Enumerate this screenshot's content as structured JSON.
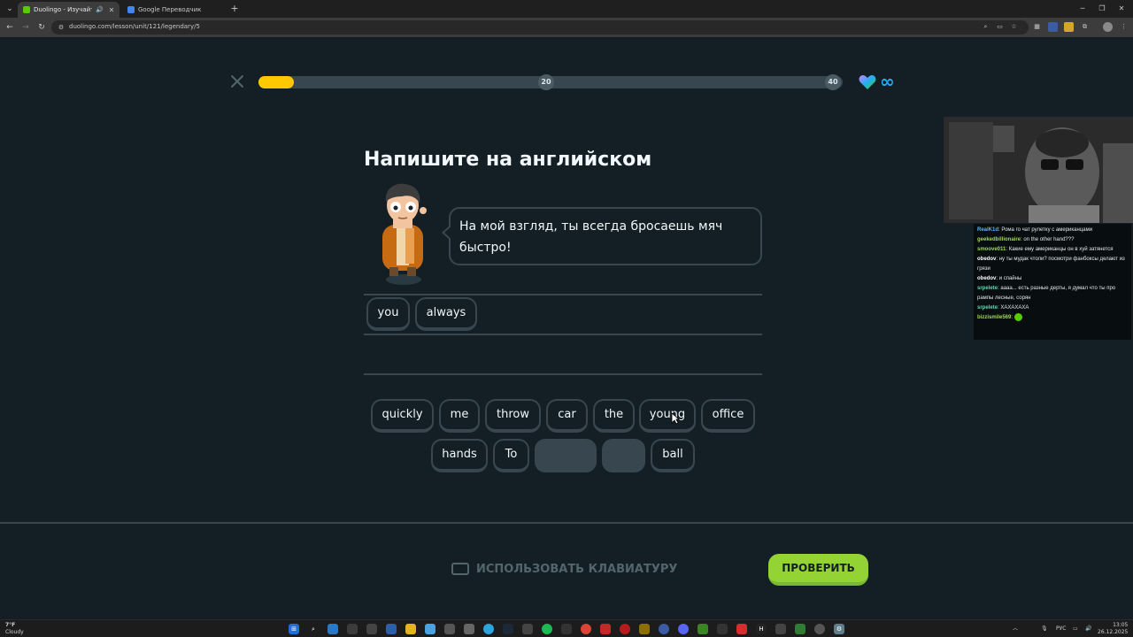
{
  "browser": {
    "tabs": [
      {
        "title": "Duolingo - Изучайте англ",
        "active": true,
        "favicon_color": "#58cc02"
      },
      {
        "title": "Google Переводчик",
        "active": false,
        "favicon_color": "#4285f4"
      }
    ],
    "url": "duolingo.com/lesson/unit/121/legendary/5"
  },
  "lesson": {
    "progress_fraction": 0.06,
    "milestones": [
      "20",
      "40"
    ],
    "hearts": "∞",
    "heading": "Напишите на английском",
    "prompt": "На мой взгляд, ты всегда бросаешь мяч быстро!",
    "answer_chips": [
      "you",
      "always"
    ],
    "bank_row1": [
      "quickly",
      "me",
      "throw",
      "car",
      "the",
      "young",
      "office"
    ],
    "bank_row2": [
      "hands",
      "To",
      "",
      "",
      "ball"
    ],
    "use_keyboard_label": "ИСПОЛЬЗОВАТЬ КЛАВИАТУРУ",
    "check_label": "ПРОВЕРИТЬ"
  },
  "colors": {
    "background": "#131f24",
    "progress": "#ffc800",
    "accent_green": "#93d333",
    "border": "#37464f"
  },
  "chat": [
    {
      "user": "RealK1d",
      "color": "#5fb4ff",
      "text": "Рома го чат рулетку с американцами"
    },
    {
      "user": "geekedbillionaire",
      "color": "#9fd65a",
      "text": "on the other hand???"
    },
    {
      "user": "smoove011",
      "color": "#9fd65a",
      "text": "Какие ему американцы он в хуй затянется"
    },
    {
      "user": "obedov",
      "color": "#ffffff",
      "text": "ну ты мудак чтоли? посмотри фанбоксы делают из грязи"
    },
    {
      "user": "obedov",
      "color": "#ffffff",
      "text": "и спайны"
    },
    {
      "user": "srpelete",
      "color": "#6bd0b0",
      "text": "аааа... есть разные дерты, я думал что ты про рампы лесные, сорян"
    },
    {
      "user": "srpelete",
      "color": "#6bd0b0",
      "text": "ХАХАХАХА"
    },
    {
      "user": "bizzismile569",
      "color": "#9fd65a",
      "text": ""
    }
  ],
  "taskbar": {
    "weather_temp": "7°F",
    "weather_desc": "Cloudy",
    "language": "РУС",
    "time": "13:05",
    "date": "26.12.2025"
  }
}
